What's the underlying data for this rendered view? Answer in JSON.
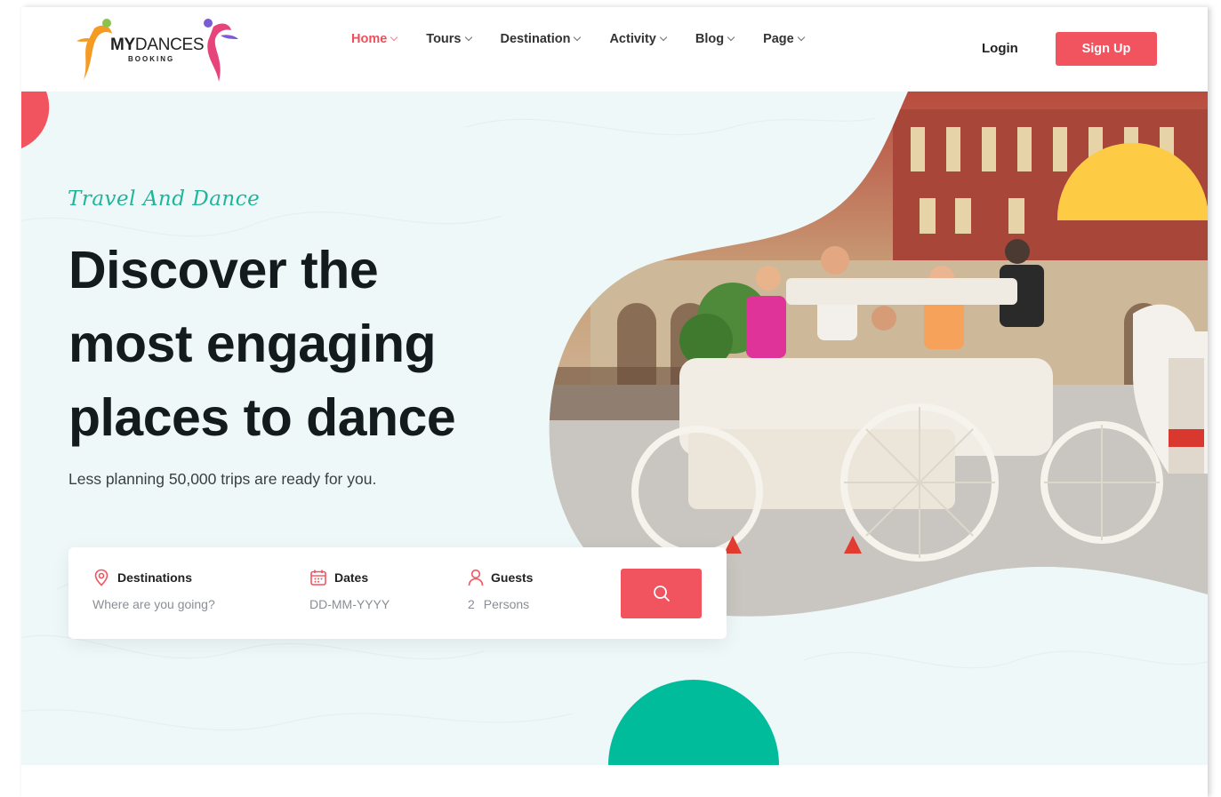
{
  "brand": {
    "name_bold": "MY",
    "name_rest": "DANCES",
    "sub": "BOOKING"
  },
  "nav": {
    "items": [
      {
        "label": "Home",
        "active": true
      },
      {
        "label": "Tours",
        "active": false
      },
      {
        "label": "Destination",
        "active": false
      },
      {
        "label": "Activity",
        "active": false
      },
      {
        "label": "Blog",
        "active": false
      },
      {
        "label": "Page",
        "active": false
      }
    ],
    "login_label": "Login",
    "signup_label": "Sign Up"
  },
  "hero": {
    "tagline": "Travel And Dance",
    "headline_lines": [
      "Discover the",
      "most engaging",
      "places to dance"
    ],
    "subtext": "Less planning 50,000 trips are ready for you."
  },
  "search": {
    "destinations": {
      "label": "Destinations",
      "placeholder": "Where are you going?",
      "icon": "map-pin-icon"
    },
    "dates": {
      "label": "Dates",
      "placeholder": "DD-MM-YYYY",
      "icon": "calendar-icon"
    },
    "guests": {
      "label": "Guests",
      "count": "2",
      "unit": "Persons",
      "icon": "user-icon"
    },
    "button_icon": "search-icon"
  },
  "colors": {
    "accent": "#f2545f",
    "teal": "#1fb59a",
    "yellow": "#fecb45",
    "green_circle": "#00bc9b",
    "hero_bg": "#eef8f8"
  }
}
